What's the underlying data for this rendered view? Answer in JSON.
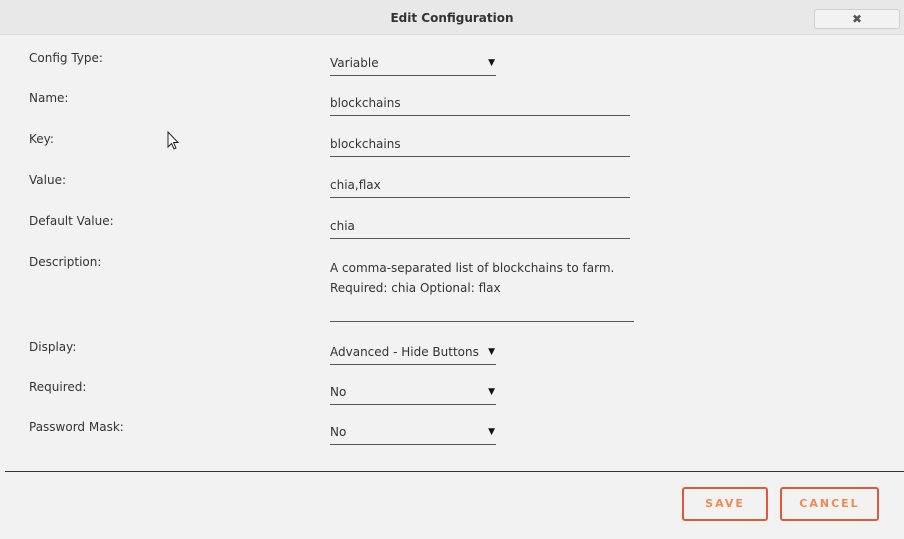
{
  "dialog": {
    "title": "Edit Configuration",
    "close_glyph": "✖"
  },
  "form": {
    "config_type": {
      "label": "Config Type:",
      "value": "Variable"
    },
    "name": {
      "label": "Name:",
      "value": "blockchains"
    },
    "key": {
      "label": "Key:",
      "value": "blockchains"
    },
    "value": {
      "label": "Value:",
      "value": "chia,flax"
    },
    "default_value": {
      "label": "Default Value:",
      "value": "chia"
    },
    "description": {
      "label": "Description:",
      "line1": "A comma-separated list of blockchains to farm.",
      "line2": "Required: chia Optional: flax"
    },
    "display": {
      "label": "Display:",
      "value": "Advanced - Hide Buttons"
    },
    "required": {
      "label": "Required:",
      "value": "No"
    },
    "password_mask": {
      "label": "Password Mask:",
      "value": "No"
    }
  },
  "footer": {
    "save_label": "SAVE",
    "cancel_label": "CANCEL"
  },
  "colors": {
    "background": "#f2f2f2",
    "button_border": "#e05a3a",
    "button_text": "#f08a52"
  },
  "icons": {
    "dropdown": "caret-down-icon",
    "close": "close-icon",
    "cursor": "mouse-pointer-icon"
  },
  "dropdown_glyph": "▼"
}
